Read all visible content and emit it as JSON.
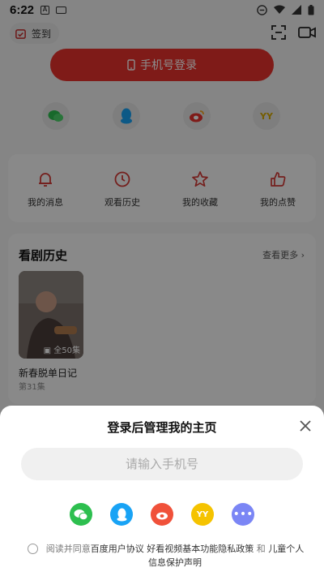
{
  "status_bar": {
    "time": "6:22"
  },
  "top": {
    "checkin_label": "签到"
  },
  "login": {
    "phone_login_label": "手机号登录"
  },
  "quick_actions": [
    {
      "label": "我的消息",
      "icon": "bell-icon"
    },
    {
      "label": "观看历史",
      "icon": "clock-icon"
    },
    {
      "label": "我的收藏",
      "icon": "star-icon"
    },
    {
      "label": "我的点赞",
      "icon": "thumbs-up-icon"
    }
  ],
  "history": {
    "title": "看剧历史",
    "more_label": "查看更多",
    "items": [
      {
        "title": "新春脱单日记",
        "episode": "第31集",
        "badge": "全50集"
      }
    ]
  },
  "sheet": {
    "title": "登录后管理我的主页",
    "phone_placeholder": "请输入手机号",
    "agree_prefix": "阅读并同意",
    "agree_link1": "百度用户协议",
    "agree_link2": "好看视频基本功能隐私政策",
    "agree_and": "和",
    "agree_link3": "儿童个人信息保护声明"
  },
  "colors": {
    "brand_red": "#e8322d",
    "wechat": "#2dbf4f",
    "qq": "#19a3f5",
    "weibo": "#f0513a",
    "yy": "#f5c300",
    "more": "#7b86f5"
  }
}
